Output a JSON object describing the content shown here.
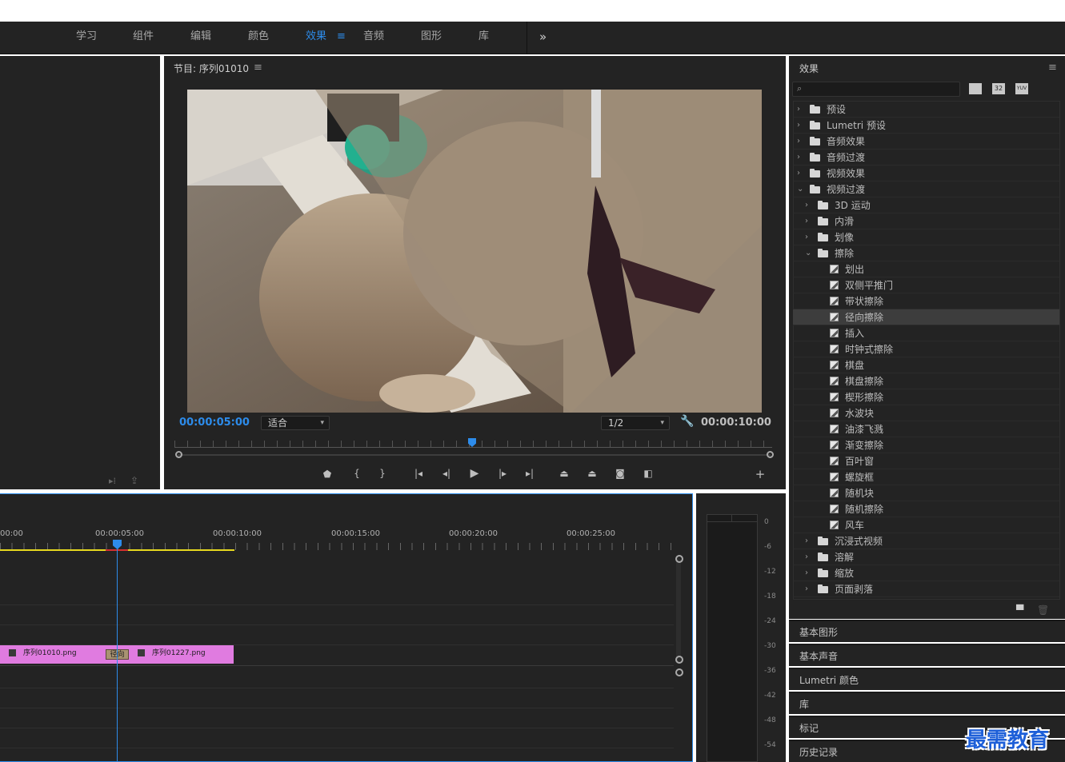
{
  "nav": {
    "items": [
      "学习",
      "组件",
      "编辑",
      "颜色",
      "效果",
      "音频",
      "图形",
      "库"
    ],
    "active": "效果",
    "more": "»"
  },
  "program": {
    "title": "节目: 序列01010",
    "menu": "≡",
    "timecode_current": "00:00:05:00",
    "timecode_total": "00:00:10:00",
    "fit_select": "适合",
    "resolution_select": "1/2"
  },
  "effects": {
    "title": "效果",
    "menu": "≡",
    "search_placeholder": "",
    "filter_icons": [
      "accelerated-effects-icon",
      "32bit-icon",
      "yuv-icon"
    ],
    "filter_labels": [
      "",
      "32",
      "YUV"
    ],
    "tree": [
      {
        "label": "预设",
        "type": "preset-folder",
        "level": 0,
        "open": false
      },
      {
        "label": "Lumetri 预设",
        "type": "preset-folder",
        "level": 0,
        "open": false
      },
      {
        "label": "音频效果",
        "type": "folder",
        "level": 0,
        "open": false
      },
      {
        "label": "音频过渡",
        "type": "folder",
        "level": 0,
        "open": false
      },
      {
        "label": "视频效果",
        "type": "folder",
        "level": 0,
        "open": false
      },
      {
        "label": "视频过渡",
        "type": "folder",
        "level": 0,
        "open": true
      },
      {
        "label": "3D 运动",
        "type": "folder",
        "level": 1,
        "open": false
      },
      {
        "label": "内滑",
        "type": "folder",
        "level": 1,
        "open": false
      },
      {
        "label": "划像",
        "type": "folder",
        "level": 1,
        "open": false
      },
      {
        "label": "擦除",
        "type": "folder",
        "level": 1,
        "open": true
      },
      {
        "label": "划出",
        "type": "effect",
        "level": 2
      },
      {
        "label": "双侧平推门",
        "type": "effect",
        "level": 2
      },
      {
        "label": "带状擦除",
        "type": "effect",
        "level": 2
      },
      {
        "label": "径向擦除",
        "type": "effect",
        "level": 2,
        "selected": true
      },
      {
        "label": "插入",
        "type": "effect",
        "level": 2
      },
      {
        "label": "时钟式擦除",
        "type": "effect",
        "level": 2
      },
      {
        "label": "棋盘",
        "type": "effect",
        "level": 2
      },
      {
        "label": "棋盘擦除",
        "type": "effect",
        "level": 2
      },
      {
        "label": "楔形擦除",
        "type": "effect",
        "level": 2
      },
      {
        "label": "水波块",
        "type": "effect",
        "level": 2
      },
      {
        "label": "油漆飞溅",
        "type": "effect",
        "level": 2
      },
      {
        "label": "渐变擦除",
        "type": "effect",
        "level": 2
      },
      {
        "label": "百叶窗",
        "type": "effect",
        "level": 2
      },
      {
        "label": "螺旋框",
        "type": "effect",
        "level": 2
      },
      {
        "label": "随机块",
        "type": "effect",
        "level": 2
      },
      {
        "label": "随机擦除",
        "type": "effect",
        "level": 2
      },
      {
        "label": "风车",
        "type": "effect",
        "level": 2
      },
      {
        "label": "沉浸式视频",
        "type": "folder",
        "level": 1,
        "open": false
      },
      {
        "label": "溶解",
        "type": "folder",
        "level": 1,
        "open": false
      },
      {
        "label": "缩放",
        "type": "folder",
        "level": 1,
        "open": false
      },
      {
        "label": "页面剥落",
        "type": "folder",
        "level": 1,
        "open": false
      }
    ]
  },
  "side_panels": [
    "基本图形",
    "基本声音",
    "Lumetri 颜色",
    "库",
    "标记",
    "历史记录"
  ],
  "timeline": {
    "ruler": [
      "00:00",
      "00:00:05:00",
      "00:00:10:00",
      "00:00:15:00",
      "00:00:20:00",
      "00:00:25:00"
    ],
    "clips": [
      {
        "name": "序列01010.png"
      },
      {
        "name": "序列01227.png"
      }
    ],
    "transition_label": "径向"
  },
  "meter": {
    "labels": [
      "0",
      "-6",
      "-12",
      "-18",
      "-24",
      "-30",
      "-36",
      "-42",
      "-48",
      "-54"
    ]
  },
  "watermark": "最需教育",
  "colors": {
    "accent": "#2d8ceb",
    "panel_bg": "#232323",
    "clip": "#e07be0",
    "workarea": "#e6d81f"
  }
}
